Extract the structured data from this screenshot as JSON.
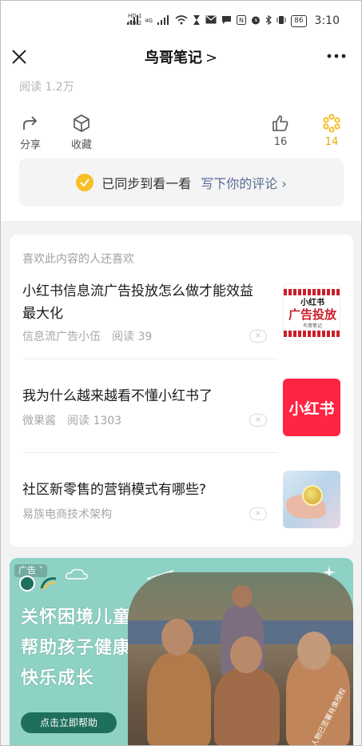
{
  "status_bar": {
    "sim_labels": [
      "HD 1",
      "HD 2"
    ],
    "signal_labels": [
      "4G",
      "4G"
    ],
    "battery": "86",
    "time": "3:10"
  },
  "nav": {
    "title": "鸟哥笔记",
    "title_chevron": ">"
  },
  "article": {
    "reads": "阅读 1.2万",
    "actions": {
      "share": "分享",
      "favorite": "收藏",
      "like_count": "16",
      "wow_count": "14"
    },
    "sync": {
      "status": "已同步到看一看",
      "comment_link": "写下你的评论 ›"
    }
  },
  "recommendations": {
    "header": "喜欢此内容的人还喜欢",
    "items": [
      {
        "title": "小红书信息流广告投放怎么做才能效益最大化",
        "source": "信息流广告小伍",
        "reads": "阅读 39",
        "thumb": {
          "top": "小红书",
          "main": "广告投放",
          "sub": "鸟哥笔记"
        }
      },
      {
        "title": "我为什么越来越看不懂小红书了",
        "source": "微果酱",
        "reads": "阅读 1303",
        "thumb": {
          "main": "小红书"
        }
      },
      {
        "title": "社区新零售的营销模式有哪些?",
        "source": "易族电商技术架构",
        "reads": "",
        "thumb": {}
      }
    ],
    "dismiss_symbol": "×"
  },
  "ad": {
    "label": "广告",
    "headline": [
      "关怀困境儿童",
      "帮助孩子健康",
      "快乐成长"
    ],
    "cta": "点击立即帮助",
    "photo_caption": "图片内人物已签署肖像授权"
  },
  "colors": {
    "accent_yellow": "#f6bf26",
    "link_blue": "#576b95",
    "xhs_red": "#ff2442",
    "ad_teal": "#8ed1c5",
    "ad_dark_green": "#1e6f5c"
  }
}
